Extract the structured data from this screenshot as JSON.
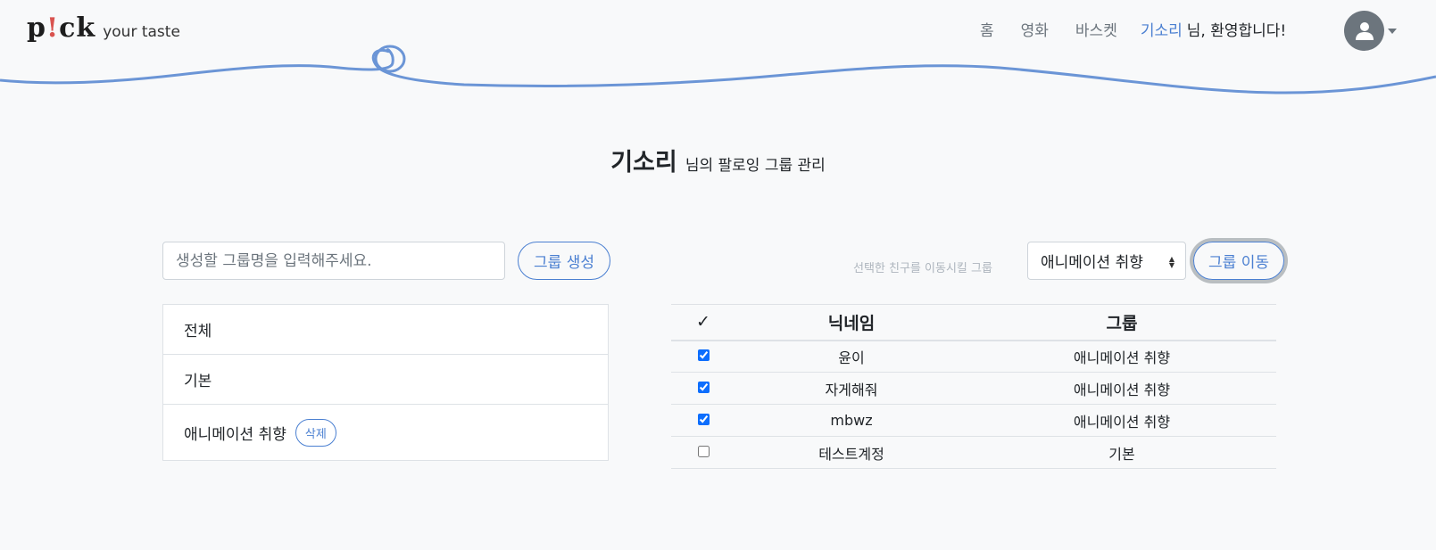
{
  "header": {
    "logo_text_a": "p",
    "logo_text_b": "!",
    "logo_text_c": "ck",
    "logo_tagline": "your taste",
    "nav": {
      "home": "홈",
      "movie": "영화",
      "basket": "바스켓"
    },
    "username": "기소리",
    "welcome_suffix": "님, 환영합니다!",
    "accent_color": "#4a7fd1"
  },
  "title": {
    "username": "기소리",
    "suffix": "님의 팔로잉 그룹 관리"
  },
  "create": {
    "placeholder": "생성할 그룹명을 입력해주세요.",
    "button": "그룹 생성"
  },
  "groups": [
    {
      "name": "전체",
      "deletable": false
    },
    {
      "name": "기본",
      "deletable": false
    },
    {
      "name": "애니메이션 취향",
      "deletable": true,
      "delete_label": "삭제"
    }
  ],
  "move": {
    "label": "선택한 친구를 이동시킬 그룹",
    "selected": "애니메이션 취향",
    "button": "그룹 이동"
  },
  "table": {
    "headers": {
      "check": "✓",
      "nickname": "닉네임",
      "group": "그룹"
    },
    "rows": [
      {
        "checked": true,
        "nickname": "윤이",
        "group": "애니메이션 취향"
      },
      {
        "checked": true,
        "nickname": "자게해줘",
        "group": "애니메이션 취향"
      },
      {
        "checked": true,
        "nickname": "mbwz",
        "group": "애니메이션 취향"
      },
      {
        "checked": false,
        "nickname": "테스트계정",
        "group": "기본"
      }
    ]
  }
}
